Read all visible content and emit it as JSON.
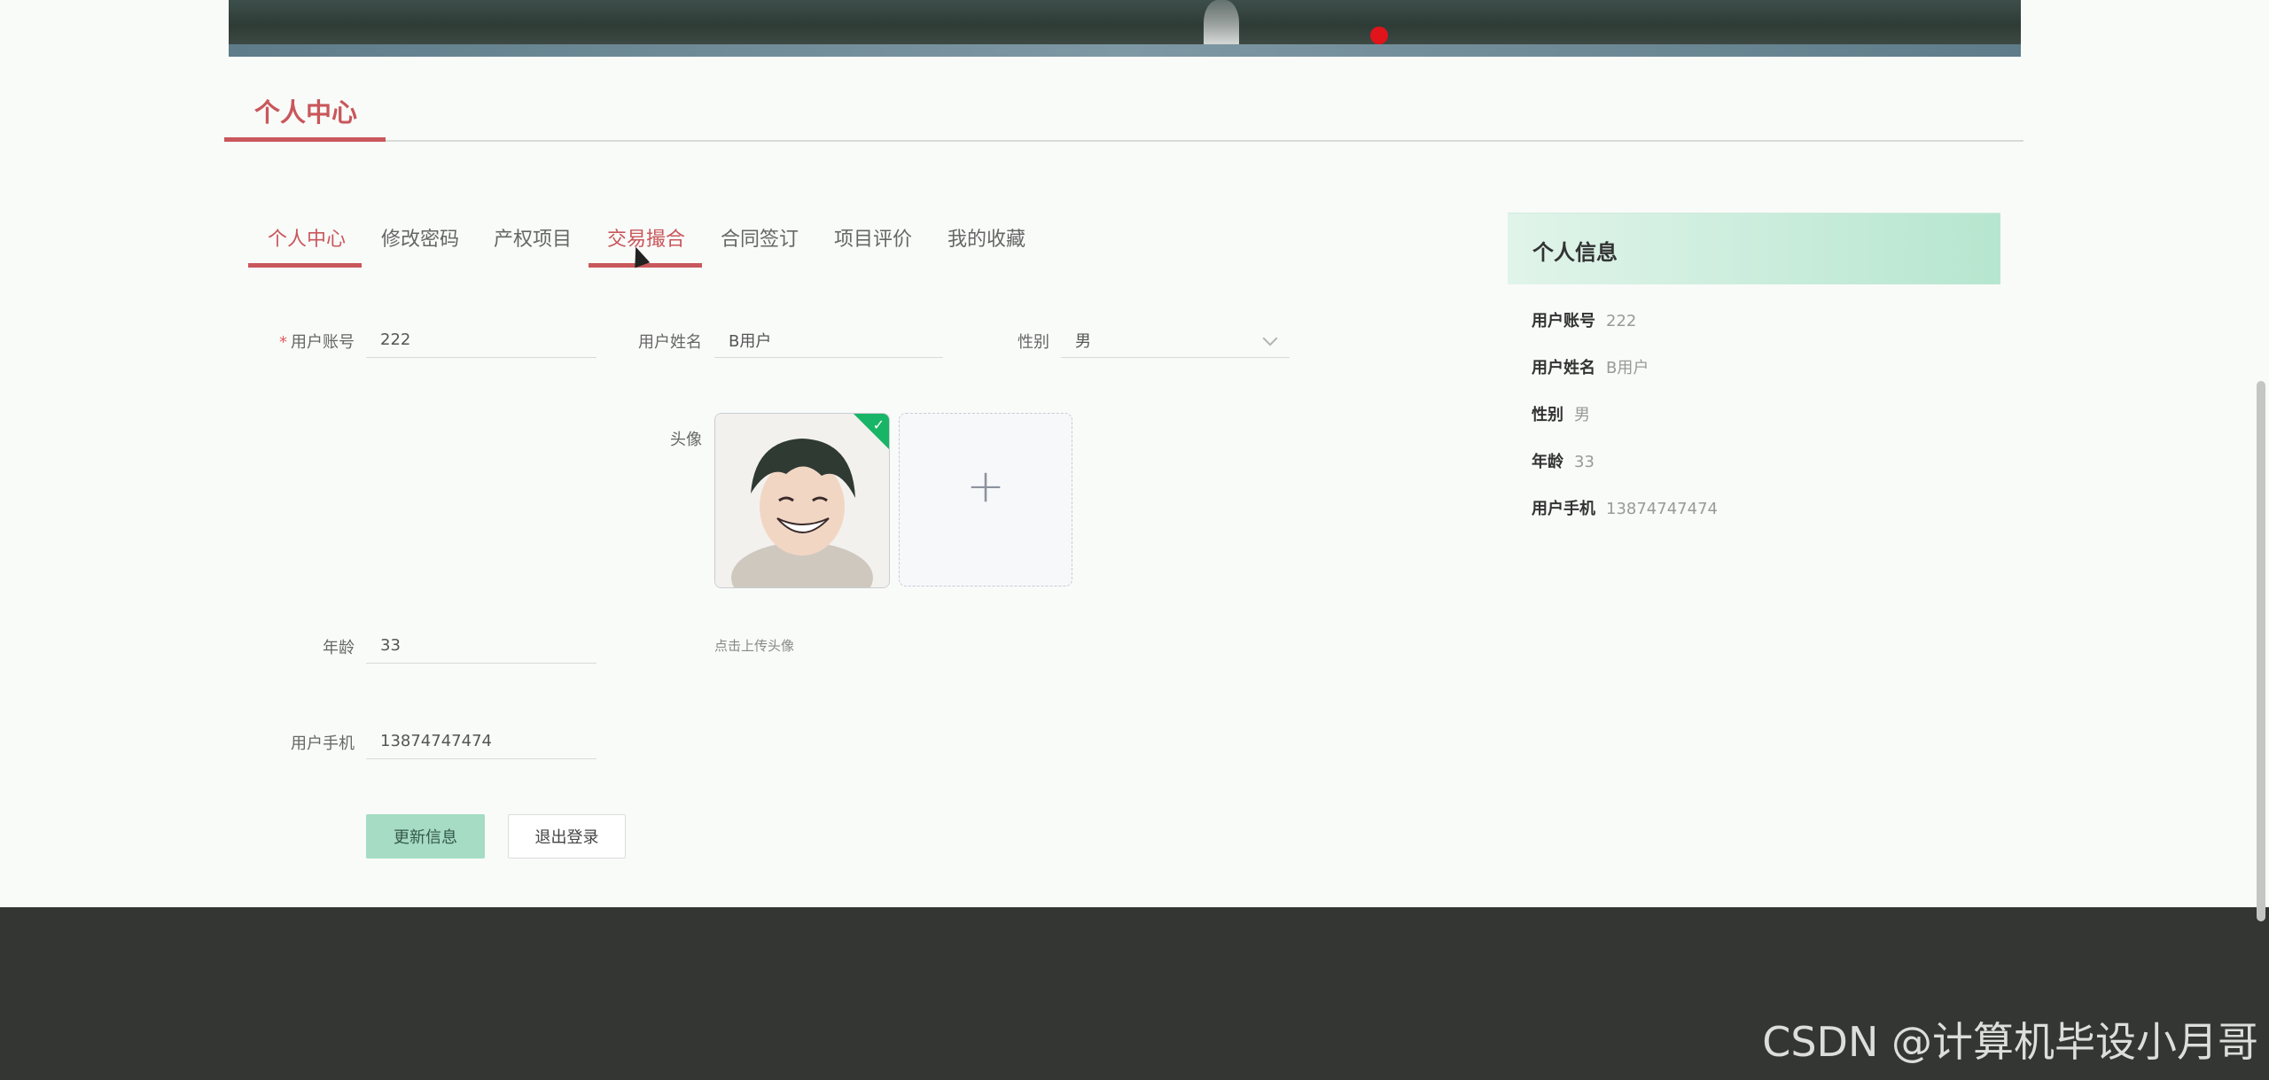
{
  "page": {
    "title": "个人中心"
  },
  "tabs": [
    {
      "label": "个人中心"
    },
    {
      "label": "修改密码"
    },
    {
      "label": "产权项目"
    },
    {
      "label": "交易撮合"
    },
    {
      "label": "合同签订"
    },
    {
      "label": "项目评价"
    },
    {
      "label": "我的收藏"
    }
  ],
  "form": {
    "required_mark": "*",
    "account": {
      "label": "用户账号",
      "value": "222"
    },
    "name": {
      "label": "用户姓名",
      "value": "B用户"
    },
    "gender": {
      "label": "性别",
      "value": "男"
    },
    "avatar": {
      "label": "头像",
      "hint": "点击上传头像",
      "upload_icon": "+"
    },
    "age": {
      "label": "年龄",
      "value": "33"
    },
    "phone": {
      "label": "用户手机",
      "value": "13874747474"
    },
    "update_button": "更新信息",
    "logout_button": "退出登录"
  },
  "info_panel": {
    "title": "个人信息",
    "rows": [
      {
        "key": "用户账号",
        "value": "222"
      },
      {
        "key": "用户姓名",
        "value": "B用户"
      },
      {
        "key": "性别",
        "value": "男"
      },
      {
        "key": "年龄",
        "value": "33"
      },
      {
        "key": "用户手机",
        "value": "13874747474"
      }
    ]
  },
  "watermark": "CSDN @计算机毕设小月哥",
  "colors": {
    "accent": "#c9575b",
    "button": "#a5dcc3",
    "footer": "#343633"
  }
}
